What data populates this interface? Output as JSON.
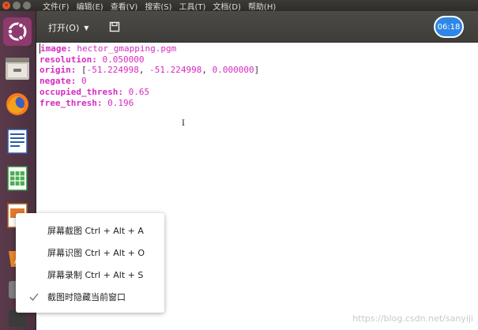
{
  "menubar": {
    "items": [
      "文件(F)",
      "编辑(E)",
      "查看(V)",
      "搜索(S)",
      "工具(T)",
      "文档(D)",
      "帮助(H)"
    ]
  },
  "toolbar": {
    "open_label": "打开(O)"
  },
  "clock": "06:18",
  "editor": {
    "lines": [
      {
        "key": "image",
        "value": "hector_gmapping.pgm"
      },
      {
        "key": "resolution",
        "value": "0.050000"
      },
      {
        "key": "origin",
        "value_parts": [
          "-51.224998",
          "-51.224998",
          "0.000000"
        ]
      },
      {
        "key": "negate",
        "value": "0"
      },
      {
        "key": "occupied_thresh",
        "value": "0.65"
      },
      {
        "key": "free_thresh",
        "value": "0.196"
      }
    ]
  },
  "context_menu": {
    "items": [
      {
        "label": "屏幕截图 Ctrl + Alt + A",
        "checked": false
      },
      {
        "label": "屏幕识图 Ctrl + Alt + O",
        "checked": false
      },
      {
        "label": "屏幕录制 Ctrl + Alt + S",
        "checked": false
      },
      {
        "label": "截图时隐藏当前窗口",
        "checked": true
      }
    ]
  },
  "watermark": "https://blog.csdn.net/sanyiji",
  "colors": {
    "syntax_key": "#d72ac0",
    "clock_bg": "#2e86e6",
    "close_button": "#e2572c",
    "launcher_bg": "#5a3a4a"
  }
}
